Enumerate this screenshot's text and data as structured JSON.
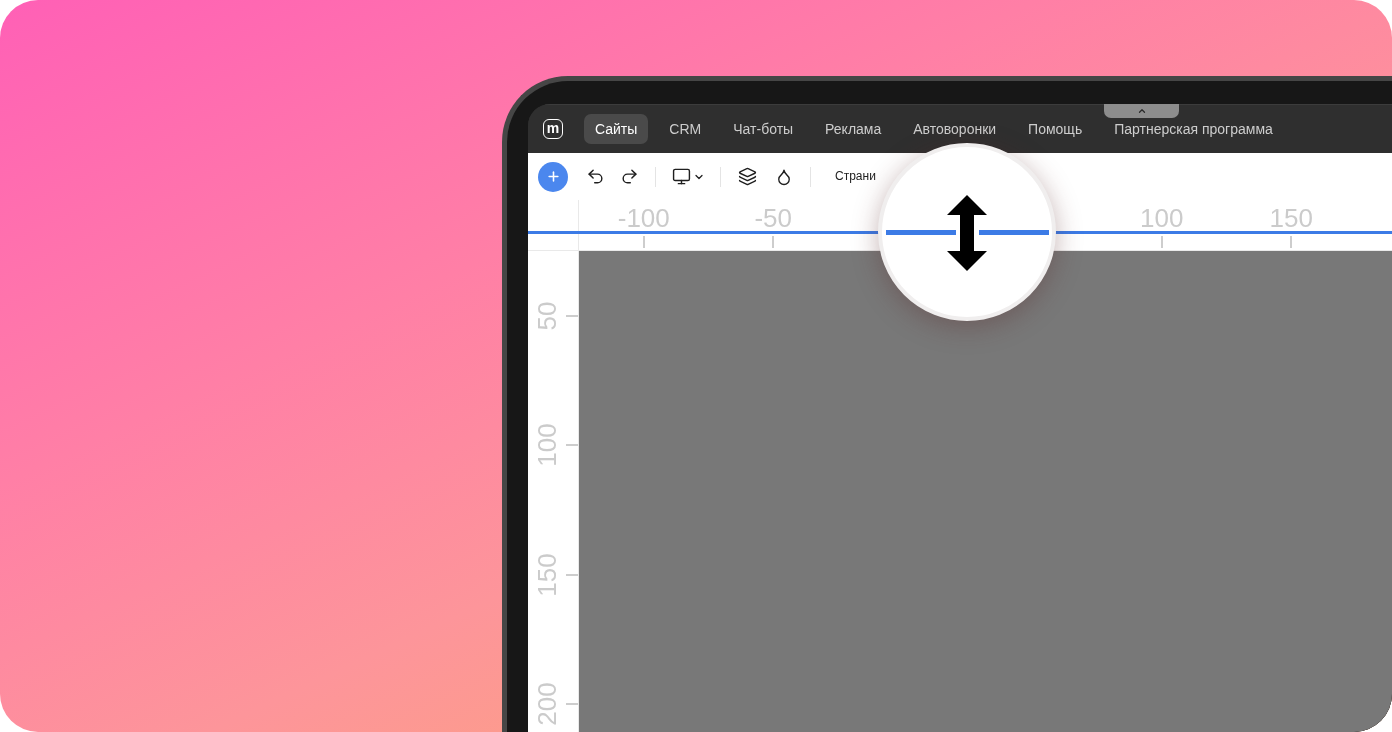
{
  "nav": {
    "logo": "m",
    "items": [
      {
        "label": "Сайты",
        "selected": true
      },
      {
        "label": "CRM",
        "selected": false
      },
      {
        "label": "Чат-боты",
        "selected": false
      },
      {
        "label": "Реклама",
        "selected": false
      },
      {
        "label": "Автоворонки",
        "selected": false
      },
      {
        "label": "Помощь",
        "selected": false
      },
      {
        "label": "Партнерская программа",
        "selected": false
      }
    ]
  },
  "toolbar": {
    "page_selector": "Страни"
  },
  "top_ruler": {
    "ticks_before_magnifier": [
      "-100",
      "-50"
    ],
    "ticks_after_magnifier": [
      "100",
      "150"
    ]
  },
  "left_ruler": {
    "ticks": [
      "50",
      "100",
      "150",
      "200"
    ]
  }
}
